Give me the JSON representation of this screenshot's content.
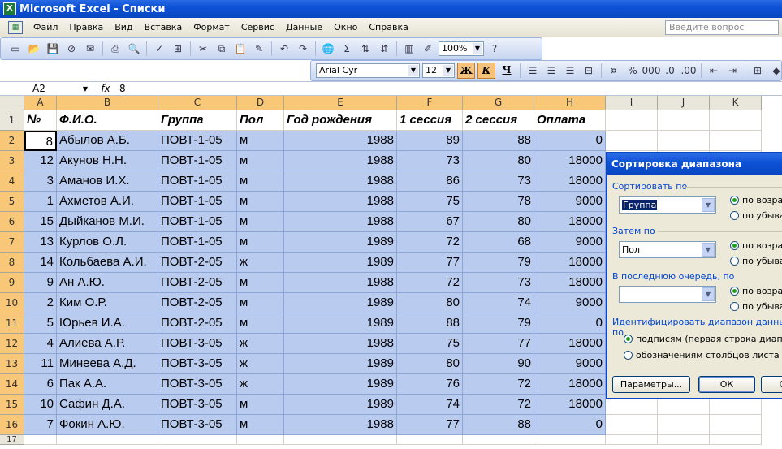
{
  "window": {
    "title": "Microsoft Excel - Списки"
  },
  "menu": {
    "items": [
      "Файл",
      "Правка",
      "Вид",
      "Вставка",
      "Формат",
      "Сервис",
      "Данные",
      "Окно",
      "Справка"
    ],
    "question_placeholder": "Введите вопрос"
  },
  "toolbar": {
    "zoom": "100%"
  },
  "format_toolbar": {
    "font": "Arial Cyr",
    "size": "12",
    "bold": "Ж",
    "italic": "К",
    "underline": "Ч"
  },
  "formula_bar": {
    "cell_ref": "A2",
    "fx": "fx",
    "value": "8"
  },
  "columns": [
    "A",
    "B",
    "C",
    "D",
    "E",
    "F",
    "G",
    "H",
    "I",
    "J",
    "K"
  ],
  "table": {
    "headers": [
      "№",
      "Ф.И.О.",
      "Группа",
      "Пол",
      "Год рождения",
      "1 сессия",
      "2 сессия",
      "Оплата"
    ],
    "rows": [
      [
        "8",
        "Абылов А.Б.",
        "ПОВТ-1-05",
        "м",
        "1988",
        "89",
        "88",
        "0"
      ],
      [
        "12",
        "Акунов Н.Н.",
        "ПОВТ-1-05",
        "м",
        "1988",
        "73",
        "80",
        "18000"
      ],
      [
        "3",
        "Аманов И.Х.",
        "ПОВТ-1-05",
        "м",
        "1988",
        "86",
        "73",
        "18000"
      ],
      [
        "1",
        "Ахметов А.И.",
        "ПОВТ-1-05",
        "м",
        "1988",
        "75",
        "78",
        "9000"
      ],
      [
        "15",
        "Дыйканов М.И.",
        "ПОВТ-1-05",
        "м",
        "1988",
        "67",
        "80",
        "18000"
      ],
      [
        "13",
        "Курлов О.Л.",
        "ПОВТ-1-05",
        "м",
        "1989",
        "72",
        "68",
        "9000"
      ],
      [
        "14",
        "Кольбаева А.И.",
        "ПОВТ-2-05",
        "ж",
        "1989",
        "77",
        "79",
        "18000"
      ],
      [
        "9",
        "Ан А.Ю.",
        "ПОВТ-2-05",
        "м",
        "1988",
        "72",
        "73",
        "18000"
      ],
      [
        "2",
        "Ким О.Р.",
        "ПОВТ-2-05",
        "м",
        "1989",
        "80",
        "74",
        "9000"
      ],
      [
        "5",
        "Юрьев И.А.",
        "ПОВТ-2-05",
        "м",
        "1989",
        "88",
        "79",
        "0"
      ],
      [
        "4",
        "Алиева А.Р.",
        "ПОВТ-3-05",
        "ж",
        "1988",
        "75",
        "77",
        "18000"
      ],
      [
        "11",
        "Минеева А.Д.",
        "ПОВТ-3-05",
        "ж",
        "1989",
        "80",
        "90",
        "9000"
      ],
      [
        "6",
        "Пак А.А.",
        "ПОВТ-3-05",
        "ж",
        "1989",
        "76",
        "72",
        "18000"
      ],
      [
        "10",
        "Сафин Д.А.",
        "ПОВТ-3-05",
        "м",
        "1989",
        "74",
        "72",
        "18000"
      ],
      [
        "7",
        "Фокин А.Ю.",
        "ПОВТ-3-05",
        "м",
        "1988",
        "77",
        "88",
        "0"
      ]
    ],
    "row_numbers": [
      "1",
      "2",
      "3",
      "4",
      "5",
      "6",
      "7",
      "8",
      "9",
      "10",
      "11",
      "12",
      "13",
      "14",
      "15",
      "16",
      "17"
    ]
  },
  "dialog": {
    "title": "Сортировка диапазона",
    "sort_by_label": "Сортировать по",
    "sort_by_value": "Группа",
    "then_by_label": "Затем по",
    "then_by_value": "Пол",
    "last_by_label": "В последнюю очередь, по",
    "last_by_value": "",
    "asc": "по возрас",
    "desc": "по убыван",
    "identify_label": "Идентифицировать диапазон данных по",
    "by_headers": "подписям (первая строка диапазон",
    "by_columns": "обозначениям столбцов листа",
    "params_button": "Параметры...",
    "ok_button": "ОК",
    "cancel_button": "От"
  }
}
